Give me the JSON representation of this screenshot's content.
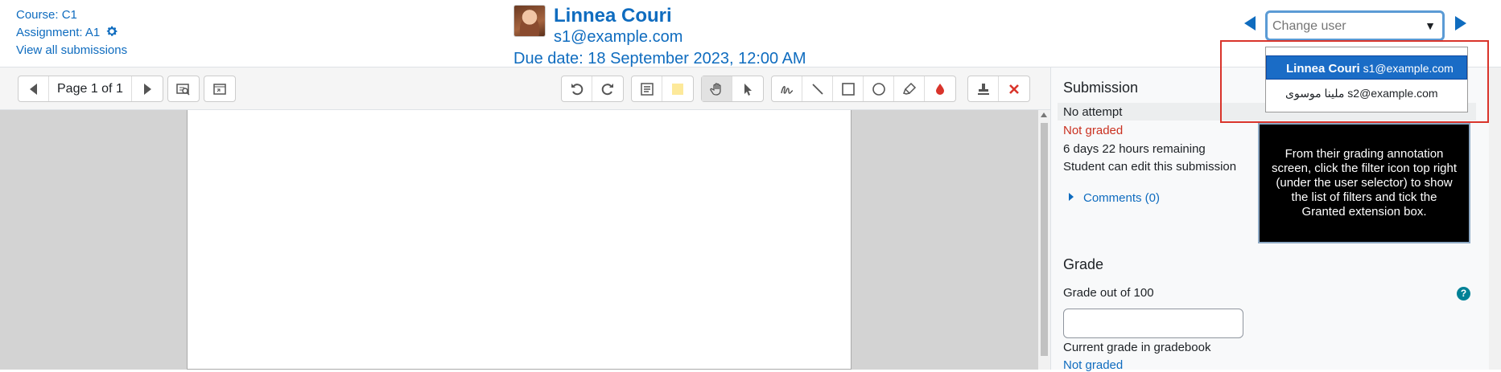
{
  "header": {
    "course_link": "Course: C1",
    "assignment_link": "Assignment: A1",
    "view_all": "View all submissions",
    "user_name": "Linnea Couri",
    "user_email": "s1@example.com",
    "due_date": "Due date: 18 September 2023, 12:00 AM"
  },
  "user_selector": {
    "placeholder": "Change user",
    "options": [
      {
        "name": "Linnea Couri",
        "email": "s1@example.com"
      },
      {
        "name": "ملينا موسوى",
        "email": "s2@example.com"
      }
    ]
  },
  "toolbar": {
    "page_label": "Page 1 of 1"
  },
  "panel": {
    "submission_heading": "Submission",
    "attempt_status": "No attempt",
    "grading_status": "Not graded",
    "time_remaining": "6 days 22 hours remaining",
    "edit_status": "Student can edit this submission",
    "comments": "Comments (0)",
    "grade_heading": "Grade",
    "grade_out_of": "Grade out of 100",
    "current_grade_label": "Current grade in gradebook",
    "current_grade_value": "Not graded"
  },
  "tooltip": {
    "text": "From their grading annotation screen, click the filter icon top right (under the user selector) to show the list of filters and tick the Granted extension box."
  },
  "colors": {
    "link": "#0f6cbf",
    "danger": "#ca3120",
    "highlight_border": "#d9342b"
  }
}
